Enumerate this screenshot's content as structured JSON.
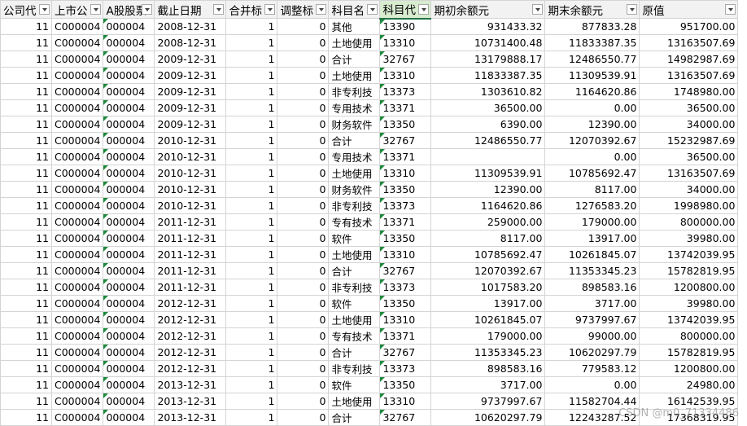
{
  "columns": [
    {
      "label": "公司代",
      "align": "num"
    },
    {
      "label": "上市公",
      "align": "txt"
    },
    {
      "label": "A股股票",
      "align": "txt"
    },
    {
      "label": "截止日期",
      "align": "txt"
    },
    {
      "label": "合并标",
      "align": "num"
    },
    {
      "label": "调整标",
      "align": "num"
    },
    {
      "label": "科目名",
      "align": "txt"
    },
    {
      "label": "科目代",
      "align": "txt"
    },
    {
      "label": "期初余额元",
      "align": "num"
    },
    {
      "label": "期末余额元",
      "align": "num"
    },
    {
      "label": "原值",
      "align": "num"
    }
  ],
  "active_column": 7,
  "rows": [
    [
      "11",
      "C000004",
      "000004",
      "2008-12-31",
      "1",
      "0",
      "其他",
      "13390",
      "931433.32",
      "877833.28",
      "951700.00"
    ],
    [
      "11",
      "C000004",
      "000004",
      "2008-12-31",
      "1",
      "0",
      "土地使用",
      "13310",
      "10731400.48",
      "11833387.35",
      "13163507.69"
    ],
    [
      "11",
      "C000004",
      "000004",
      "2009-12-31",
      "1",
      "0",
      "合计",
      "32767",
      "13179888.17",
      "12486550.77",
      "14982987.69"
    ],
    [
      "11",
      "C000004",
      "000004",
      "2009-12-31",
      "1",
      "0",
      "土地使用",
      "13310",
      "11833387.35",
      "11309539.91",
      "13163507.69"
    ],
    [
      "11",
      "C000004",
      "000004",
      "2009-12-31",
      "1",
      "0",
      "非专利技",
      "13373",
      "1303610.82",
      "1164620.86",
      "1748980.00"
    ],
    [
      "11",
      "C000004",
      "000004",
      "2009-12-31",
      "1",
      "0",
      "专用技术",
      "13371",
      "36500.00",
      "0.00",
      "36500.00"
    ],
    [
      "11",
      "C000004",
      "000004",
      "2009-12-31",
      "1",
      "0",
      "财务软件",
      "13350",
      "6390.00",
      "12390.00",
      "34000.00"
    ],
    [
      "11",
      "C000004",
      "000004",
      "2010-12-31",
      "1",
      "0",
      "合计",
      "32767",
      "12486550.77",
      "12070392.67",
      "15232987.69"
    ],
    [
      "11",
      "C000004",
      "000004",
      "2010-12-31",
      "1",
      "0",
      "专用技术",
      "13371",
      "",
      "0.00",
      "36500.00"
    ],
    [
      "11",
      "C000004",
      "000004",
      "2010-12-31",
      "1",
      "0",
      "土地使用",
      "13310",
      "11309539.91",
      "10785692.47",
      "13163507.69"
    ],
    [
      "11",
      "C000004",
      "000004",
      "2010-12-31",
      "1",
      "0",
      "财务软件",
      "13350",
      "12390.00",
      "8117.00",
      "34000.00"
    ],
    [
      "11",
      "C000004",
      "000004",
      "2010-12-31",
      "1",
      "0",
      "非专利技",
      "13373",
      "1164620.86",
      "1276583.20",
      "1998980.00"
    ],
    [
      "11",
      "C000004",
      "000004",
      "2011-12-31",
      "1",
      "0",
      "专有技术",
      "13371",
      "259000.00",
      "179000.00",
      "800000.00"
    ],
    [
      "11",
      "C000004",
      "000004",
      "2011-12-31",
      "1",
      "0",
      "软件",
      "13350",
      "8117.00",
      "13917.00",
      "39980.00"
    ],
    [
      "11",
      "C000004",
      "000004",
      "2011-12-31",
      "1",
      "0",
      "土地使用",
      "13310",
      "10785692.47",
      "10261845.07",
      "13742039.95"
    ],
    [
      "11",
      "C000004",
      "000004",
      "2011-12-31",
      "1",
      "0",
      "合计",
      "32767",
      "12070392.67",
      "11353345.23",
      "15782819.95"
    ],
    [
      "11",
      "C000004",
      "000004",
      "2011-12-31",
      "1",
      "0",
      "非专利技",
      "13373",
      "1017583.20",
      "898583.16",
      "1200800.00"
    ],
    [
      "11",
      "C000004",
      "000004",
      "2012-12-31",
      "1",
      "0",
      "软件",
      "13350",
      "13917.00",
      "3717.00",
      "39980.00"
    ],
    [
      "11",
      "C000004",
      "000004",
      "2012-12-31",
      "1",
      "0",
      "土地使用",
      "13310",
      "10261845.07",
      "9737997.67",
      "13742039.95"
    ],
    [
      "11",
      "C000004",
      "000004",
      "2012-12-31",
      "1",
      "0",
      "专有技术",
      "13371",
      "179000.00",
      "99000.00",
      "800000.00"
    ],
    [
      "11",
      "C000004",
      "000004",
      "2012-12-31",
      "1",
      "0",
      "合计",
      "32767",
      "11353345.23",
      "10620297.79",
      "15782819.95"
    ],
    [
      "11",
      "C000004",
      "000004",
      "2012-12-31",
      "1",
      "0",
      "非专利技",
      "13373",
      "898583.16",
      "779583.12",
      "1200800.00"
    ],
    [
      "11",
      "C000004",
      "000004",
      "2013-12-31",
      "1",
      "0",
      "软件",
      "13350",
      "3717.00",
      "0.00",
      "24980.00"
    ],
    [
      "11",
      "C000004",
      "000004",
      "2013-12-31",
      "1",
      "0",
      "土地使用",
      "13310",
      "9737997.67",
      "11582704.44",
      "16142539.95"
    ],
    [
      "11",
      "C000004",
      "000004",
      "2013-12-31",
      "1",
      "0",
      "合计",
      "32767",
      "10620297.79",
      "12243287.52",
      "17368319.95"
    ]
  ],
  "watermark": "CSDN @m0_71334486"
}
